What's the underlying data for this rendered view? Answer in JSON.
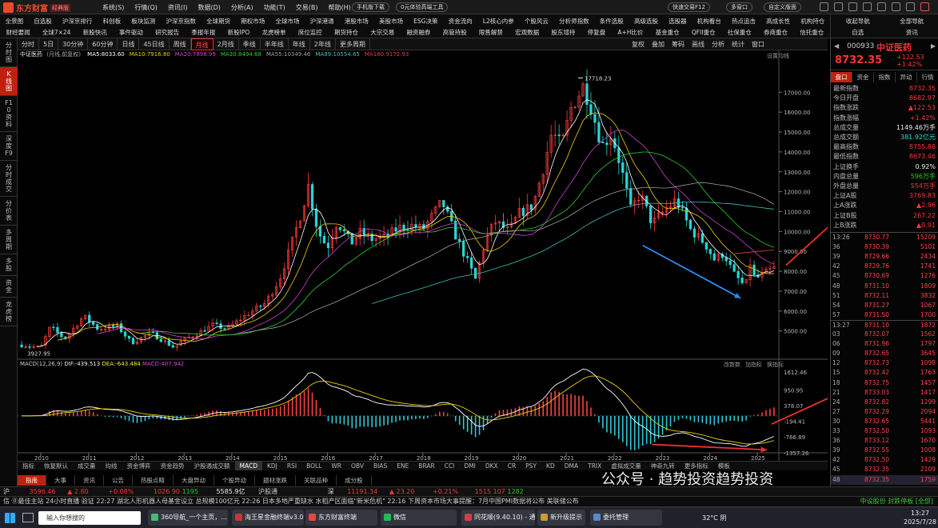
{
  "app": {
    "logo": "东方财富",
    "edition": "经典版",
    "menu": [
      "系统(S)",
      "行情(Q)",
      "资讯(I)",
      "数据(D)",
      "分析(A)",
      "功能(T)",
      "交易(B)",
      "帮助(H)"
    ],
    "mobile_download": "手机版下载",
    "wealth_tool": "0元体验高端工具",
    "quick_trade": "快速交易F12",
    "multi_window": "多窗口",
    "custom_layout": "自定义版面"
  },
  "nav": {
    "row1": [
      "全景图",
      "自选股",
      "沪深京排行",
      "科创板",
      "板块监测",
      "沪深京指数",
      "全球期货",
      "期权市场",
      "全球市场",
      "沪深港通",
      "港股市场",
      "美股市场",
      "ESG决策",
      "资金流向",
      "L2核心内参",
      "个股风云",
      "分析师指数",
      "条件选股",
      "高级选股",
      "选股器",
      "机构看台",
      "热点追击",
      "高成长性",
      "机构持仓"
    ],
    "row2": [
      "财经要闻",
      "全球7×24",
      "新股快讯",
      "事件驱动",
      "研究报告",
      "季报年报",
      "新股IPO",
      "龙虎榜单",
      "席位监控",
      "期货持仓",
      "大宗交易",
      "融资融券",
      "高管持股",
      "限售解禁",
      "宏观数据",
      "股东增持",
      "停复盘",
      "A+H比价",
      "基金重仓",
      "QFII重仓",
      "社保重仓",
      "券商重仓",
      "信托重仓"
    ],
    "right1": [
      "收起导航",
      "全部导航"
    ],
    "right2": [
      "自选",
      "资讯"
    ]
  },
  "left_tabs": [
    "分时图",
    "K线图",
    "F10资料",
    "深度F9",
    "分时成交",
    "分价表",
    "多周期",
    "多股",
    "资金",
    "龙虎榜"
  ],
  "periods": [
    "分时",
    "5日",
    "30分钟",
    "60分钟",
    "日线",
    "45日线",
    "周线",
    "月线",
    "2月线",
    "季线",
    "半年线",
    "年线",
    "2年线",
    "更多周期"
  ],
  "active_period": "月线",
  "tools": [
    "复权",
    "叠加",
    "筹码",
    "画线",
    "分析",
    "统计",
    "窗口"
  ],
  "chart": {
    "name": "中证医药",
    "adj": "(月线,前复权)",
    "ma": [
      {
        "k": "MA5:8033.60",
        "c": "#ffffff"
      },
      {
        "k": "MA10:7916.80",
        "c": "#f0d000"
      },
      {
        "k": "MA20:7898.99",
        "c": "#d040d0"
      },
      {
        "k": "MA30:8494.68",
        "c": "#30d030"
      },
      {
        "k": "MA55:10349.46",
        "c": "#a0a0a0"
      },
      {
        "k": "MA89:10554.65",
        "c": "#40c0c0"
      },
      {
        "k": "MA180:9172.93",
        "c": "#e04040"
      }
    ],
    "high_label": "17718.23",
    "low_label": "3927.95",
    "setting": "设置均线",
    "yticks": [
      "17000.00",
      "16000.00",
      "15000.00",
      "14000.00",
      "13000.00",
      "12000.00",
      "11000.00",
      "10000.00",
      "9000.00",
      "8000.00",
      "7000.00",
      "6000.00",
      "5000.00"
    ],
    "xticks": [
      "2010",
      "2011",
      "2012",
      "2013",
      "2014",
      "2015",
      "2016",
      "2017",
      "2018",
      "2019",
      "2020",
      "2021",
      "2022",
      "2023",
      "2024",
      "2025"
    ],
    "macd_label": "MACD(12,26,9)",
    "dif": "DIF:-439.513",
    "dea": "DEA:-643.484",
    "macd": "MACD:407.942",
    "macd_yticks": [
      "1612.46",
      "950.95",
      "378.07",
      "-194.41",
      "-766.89",
      "-1357.26"
    ],
    "macd_tools": [
      "改数数",
      "加指标",
      "换指标"
    ]
  },
  "chart_data": {
    "type": "candlestick",
    "x": [
      "2010",
      "2011",
      "2012",
      "2013",
      "2014",
      "2015",
      "2016",
      "2017",
      "2018",
      "2019",
      "2020",
      "2021",
      "2022",
      "2023",
      "2024",
      "2025"
    ],
    "series": [
      {
        "name": "K线",
        "approx_close": [
          5500,
          4800,
          4300,
          5200,
          6500,
          11000,
          9500,
          10500,
          8500,
          9500,
          13000,
          15500,
          11500,
          9500,
          7800,
          8732
        ]
      }
    ],
    "high": 17718.23,
    "low": 3927.95,
    "ylim": [
      3700,
      18500
    ],
    "macd_ylim": [
      -1357.26,
      1612.46
    ]
  },
  "indicators": [
    "指标",
    "恢复默认",
    "成交量",
    "均线",
    "资金博弈",
    "资金趋势",
    "沪股通成交额",
    "MACD",
    "KDJ",
    "RSI",
    "BOLL",
    "WR",
    "OBV",
    "BIAS",
    "ENE",
    "BRAR",
    "CCI",
    "DMI",
    "DKX",
    "CR",
    "PSY",
    "KD",
    "DMA",
    "TRIX",
    "虚拟成交量",
    "神奇九转",
    "更多指标",
    "模板"
  ],
  "subtabs": [
    "指南",
    "大事",
    "资讯",
    "公告",
    "热股点睛",
    "大盘异动",
    "个股异动",
    "题材涨跌",
    "关联品种",
    "成分股"
  ],
  "panel": {
    "code": "000933",
    "name": "中证医药",
    "price": "8732.35",
    "chg": "+122.53",
    "pct": "+1.42%",
    "tabs": [
      "盘口",
      "资金",
      "指数",
      "异动",
      "行情"
    ],
    "stats": [
      [
        "最新指数",
        "8732.35",
        "red"
      ],
      [
        "今日开盘",
        "8682.97",
        "red"
      ],
      [
        "指数涨跌",
        "▲122.53",
        "red"
      ],
      [
        "指数涨幅",
        "+1.42%",
        "red"
      ],
      [
        "总成交量",
        "1149.46万手",
        "wht"
      ],
      [
        "总成交额",
        "381.92亿元",
        "cyan"
      ],
      [
        "最高指数",
        "8755.88",
        "red"
      ],
      [
        "最低指数",
        "8673.46",
        "red"
      ],
      [
        "上证换手",
        "0.92%",
        "wht"
      ],
      [
        "内盘总量",
        "596万手",
        "green"
      ],
      [
        "外盘总量",
        "554万手",
        "red"
      ],
      [
        "上证A股",
        "3769.83",
        "red"
      ],
      [
        "上A涨跌",
        "▲2.96",
        "red"
      ],
      [
        "上证B股",
        "267.22",
        "red"
      ],
      [
        "上B涨跌",
        "▲0.91",
        "red"
      ]
    ],
    "ticks": [
      [
        "13:26",
        "8730.77",
        "15209"
      ],
      [
        "36",
        "8730.39",
        "5101"
      ],
      [
        "39",
        "8729.66",
        "2434"
      ],
      [
        "42",
        "8729.76",
        "1741"
      ],
      [
        "45",
        "8730.69",
        "1276"
      ],
      [
        "48",
        "8731.10",
        "1809"
      ],
      [
        "51",
        "8732.11",
        "3832"
      ],
      [
        "54",
        "8731.27",
        "1067"
      ],
      [
        "57",
        "8731.50",
        "1700"
      ],
      [
        "13:27",
        "8731.10",
        "1872"
      ],
      [
        "03",
        "8732.07",
        "1562"
      ],
      [
        "06",
        "8731.96",
        "1797"
      ],
      [
        "09",
        "8732.65",
        "3645"
      ],
      [
        "12",
        "8732.73",
        "1098"
      ],
      [
        "15",
        "8732.42",
        "1763"
      ],
      [
        "18",
        "8732.75",
        "1457"
      ],
      [
        "21",
        "8733.03",
        "1417"
      ],
      [
        "24",
        "8732.82",
        "1299"
      ],
      [
        "27",
        "8732.29",
        "2094"
      ],
      [
        "30",
        "8732.65",
        "5441"
      ],
      [
        "33",
        "8732.50",
        "1093"
      ],
      [
        "36",
        "8733.12",
        "1670"
      ],
      [
        "39",
        "8732.55",
        "1008"
      ],
      [
        "42",
        "8732.50",
        "1429"
      ],
      [
        "45",
        "8732.35",
        "2109"
      ],
      [
        "48",
        "8732.35",
        "1759"
      ]
    ]
  },
  "status": {
    "sh": "沪",
    "sh_val": "3596.46",
    "sh_arrow": "▲",
    "sh_chg": "2.80",
    "sh_pct": "+0.08%",
    "sh_vol": "1026",
    "sh_n": "90",
    "sh_n2": "1195",
    "sh_amt": "5585.9亿",
    "hgt": "沪股通",
    "sz": "深",
    "sz_val": "11191.34",
    "sz_arrow": "▲",
    "sz_chg": "23.20",
    "sz_pct": "+0.21%",
    "sz_vol": "1515",
    "sz_n": "107",
    "sz_n2": "1282",
    "ticker": "信 ⓪最佳主站 24小时直播 验证 22:27 湖北人形机器人母基金设立 总规模100亿元 22:26 日本多地严重缺水 水稻产区面临\"新米危机\" 22:16 下周资本市场大事提醒：7月中国PMI数据将公布 美联储公布",
    "right": "中设股份 封跌停板 [全部]"
  },
  "watermark": "公众号 · 趋势投资趋势投资",
  "taskbar": {
    "search": "输入你想搜的",
    "apps": [
      "360导航_一个主页，...",
      "海王星金融终端v3.0-...",
      "东方财富终端",
      "微信",
      "同花顺(9.40.10) - 通...",
      "新升级提示",
      "委托管理"
    ],
    "temp": "32°C",
    "weather": "阴",
    "clock": "13:27",
    "date": "2025/7/28"
  }
}
